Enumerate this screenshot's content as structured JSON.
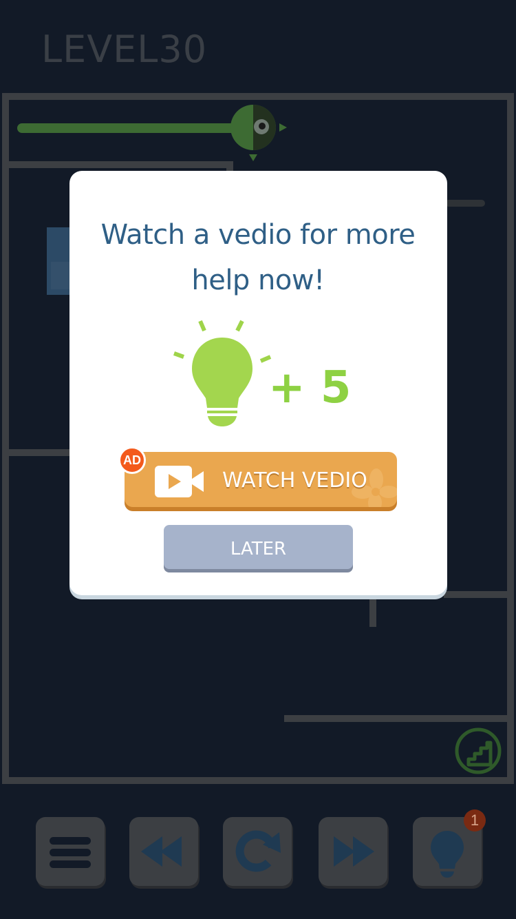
{
  "game": {
    "level_label": "LEVEL30"
  },
  "dialog": {
    "title": "Watch a vedio for more help now!",
    "reward_text": "+ 5",
    "reward_icon": "lightbulb-icon",
    "ad_badge": "AD",
    "watch_button_label": "WATCH VEDIO",
    "watch_button_icon": "video-camera-icon",
    "later_button_label": "LATER"
  },
  "toolbar": {
    "buttons": [
      {
        "name": "menu",
        "icon": "menu-icon"
      },
      {
        "name": "previous-level",
        "icon": "rewind-icon"
      },
      {
        "name": "restart",
        "icon": "restart-icon"
      },
      {
        "name": "next-level",
        "icon": "fast-forward-icon"
      },
      {
        "name": "hint",
        "icon": "lightbulb-icon"
      }
    ],
    "hint_count": "1"
  },
  "colors": {
    "background": "#121a27",
    "title": "#2f5f86",
    "reward_green": "#8ed143",
    "watch_button": "#eaa74f",
    "later_button": "#a6b3cb",
    "ad_badge": "#f35a1c"
  }
}
